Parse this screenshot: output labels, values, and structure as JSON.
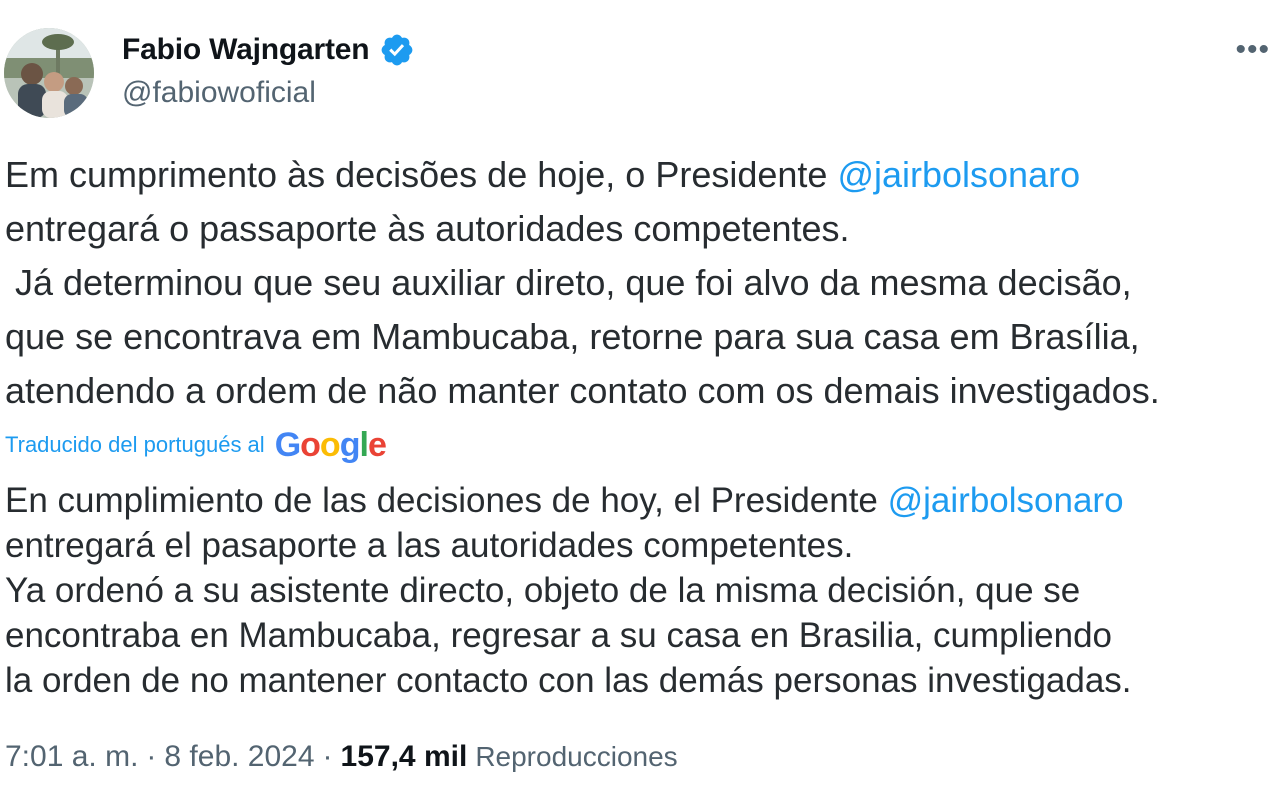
{
  "author": {
    "display_name": "Fabio Wajngarten",
    "handle": "@fabiowoficial",
    "verified": true,
    "avatar_icon": "profile-photo"
  },
  "more_icon": "•••",
  "original": {
    "line1_prefix": "Em cumprimento às decisões de hoje, o Presidente ",
    "line1_mention": "@jairbolsonaro",
    "line2": "entregará o passaporte às autoridades competentes.",
    "line3": " Já determinou que seu auxiliar direto, que foi alvo da mesma decisão,",
    "line4": "que se encontrava em Mambucaba, retorne para sua casa em Brasília,",
    "line5": "atendendo a ordem de não manter contato com os demais investigados."
  },
  "translation_notice": {
    "label": "Traducido del portugués al",
    "provider_letters": [
      "G",
      "o",
      "o",
      "g",
      "l",
      "e"
    ]
  },
  "translated": {
    "line1_prefix": "En cumplimiento de las decisiones de hoy, el Presidente ",
    "line1_mention": "@jairbolsonaro",
    "line2": "entregará el pasaporte a las autoridades competentes.",
    "line3": "Ya ordenó a su asistente directo, objeto de la misma decisión, que se",
    "line4": "encontraba en Mambucaba, regresar a su casa en Brasilia, cumpliendo",
    "line5": "la orden de no mantener contacto con las demás personas investigadas."
  },
  "meta": {
    "time": "7:01 a. m.",
    "separator": "·",
    "date": "8 feb. 2024",
    "views_count": "157,4 mil",
    "views_label": "Reproducciones"
  },
  "colors": {
    "mention": "#1d9bf0",
    "secondary": "#536471",
    "verified_badge": "#1d9bf0"
  }
}
